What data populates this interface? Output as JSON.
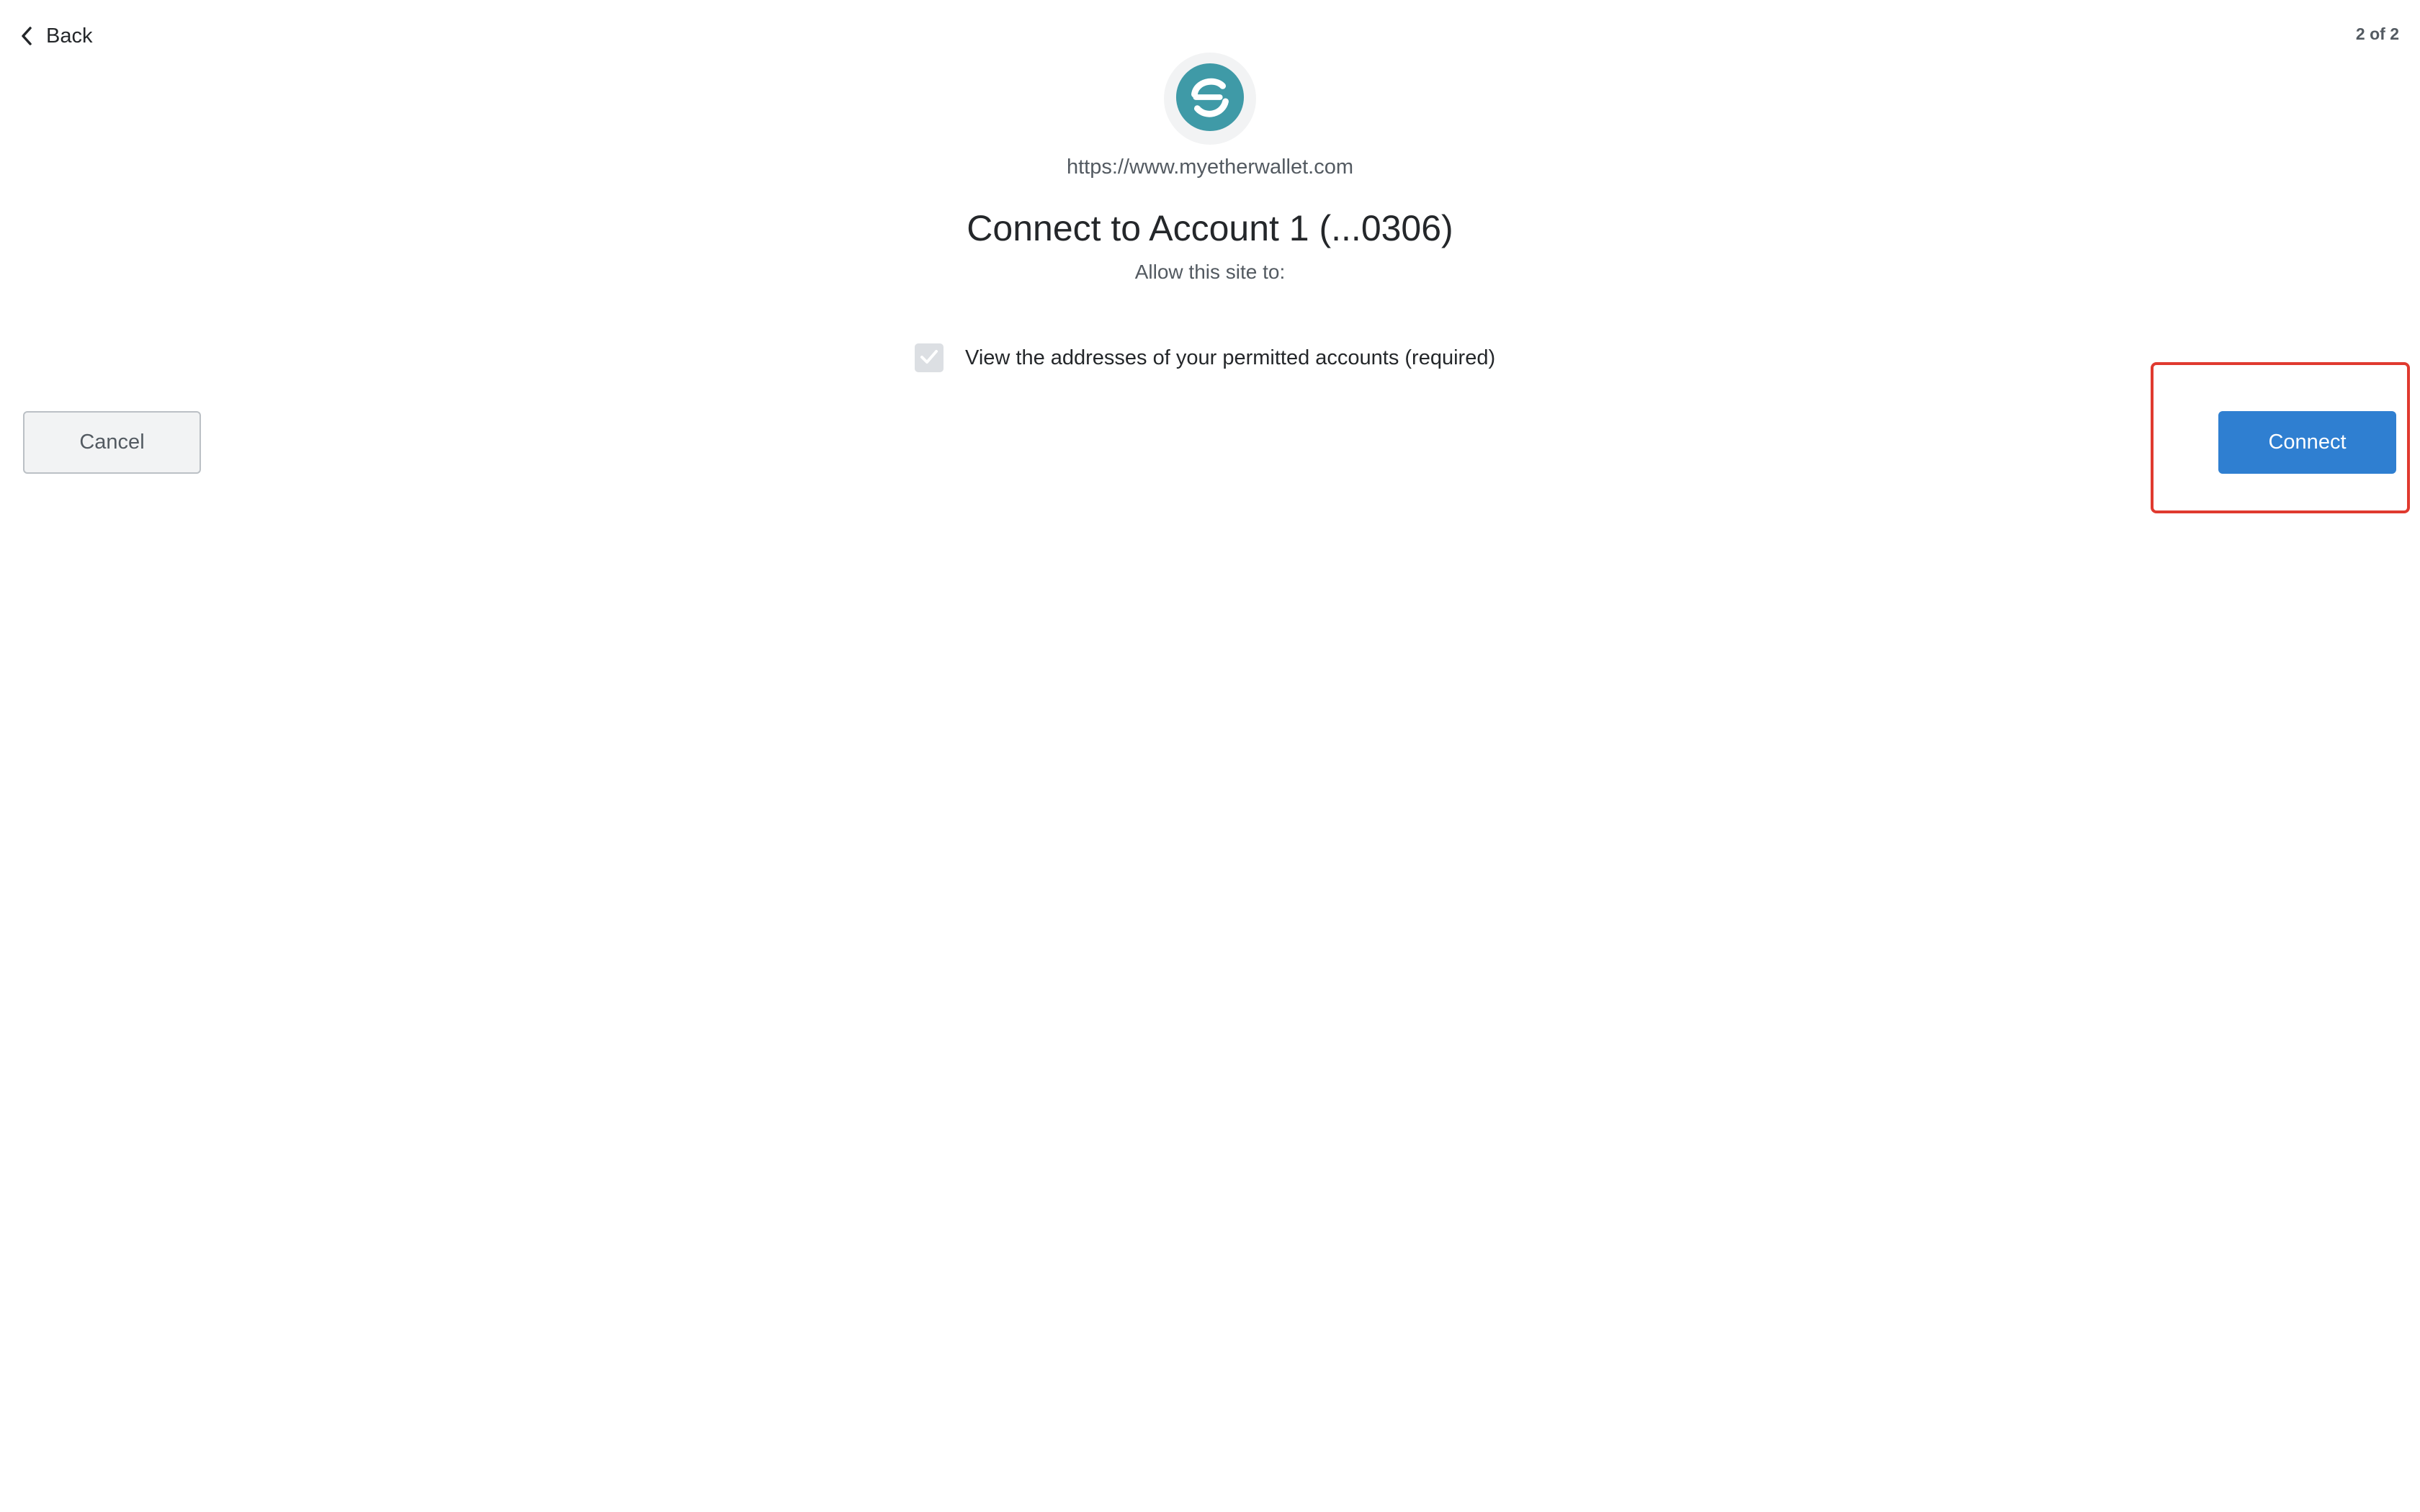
{
  "header": {
    "back_label": "Back",
    "step_counter": "2 of 2"
  },
  "site": {
    "icon": "myetherwallet-logo-icon",
    "url": "https://www.myetherwallet.com"
  },
  "main": {
    "title": "Connect to Account 1 (...0306)",
    "subtitle": "Allow this site to:",
    "permissions": [
      {
        "label": "View the addresses of your permitted accounts (required)",
        "checked": true,
        "disabled": true
      }
    ]
  },
  "actions": {
    "cancel_label": "Cancel",
    "connect_label": "Connect"
  },
  "colors": {
    "primary": "#2f7fd1",
    "highlight": "#e03a2f",
    "logo": "#3f9aa7"
  }
}
